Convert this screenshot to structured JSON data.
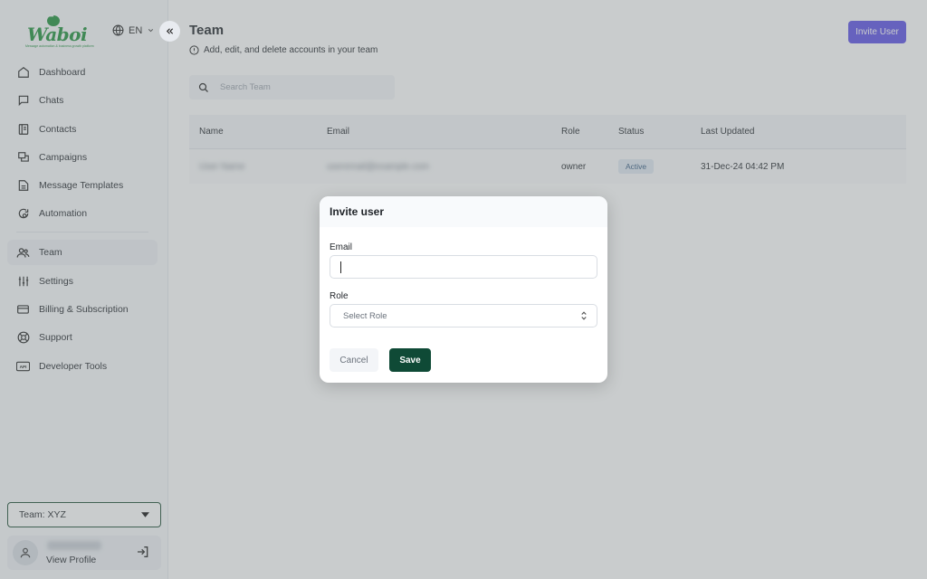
{
  "brand": {
    "name": "Waboi",
    "tagline": "Message automation & business growth platform",
    "color": "#1d8f3a"
  },
  "language": {
    "code": "EN"
  },
  "sidebar": {
    "items": [
      {
        "label": "Dashboard",
        "icon": "home-icon"
      },
      {
        "label": "Chats",
        "icon": "chat-icon"
      },
      {
        "label": "Contacts",
        "icon": "contacts-icon"
      },
      {
        "label": "Campaigns",
        "icon": "campaigns-icon"
      },
      {
        "label": "Message Templates",
        "icon": "template-icon"
      },
      {
        "label": "Automation",
        "icon": "automation-icon"
      },
      {
        "label": "Team",
        "icon": "team-icon",
        "active": true
      },
      {
        "label": "Settings",
        "icon": "sliders-icon"
      },
      {
        "label": "Billing & Subscription",
        "icon": "card-icon"
      },
      {
        "label": "Support",
        "icon": "lifebuoy-icon"
      },
      {
        "label": "Developer Tools",
        "icon": "api-icon"
      }
    ],
    "team_select": "Team: XYZ",
    "profile": {
      "name": "User Name",
      "link": "View Profile"
    }
  },
  "header": {
    "title": "Team",
    "subtitle": "Add, edit, and delete accounts in your team",
    "invite_button": "Invite User"
  },
  "search": {
    "placeholder": "Search Team"
  },
  "table": {
    "columns": [
      "Name",
      "Email",
      "Role",
      "Status",
      "Last Updated"
    ],
    "rows": [
      {
        "name": "User Name",
        "email": "useremail@example.com",
        "role": "owner",
        "status": "Active",
        "updated": "31-Dec-24 04:42 PM"
      }
    ]
  },
  "modal": {
    "title": "Invite user",
    "email_label": "Email",
    "email_value": "",
    "role_label": "Role",
    "role_placeholder": "Select Role",
    "cancel": "Cancel",
    "save": "Save"
  },
  "colors": {
    "primary": "#5b4fe6",
    "save": "#0f4a36",
    "team_border": "#1d4d34",
    "active_badge_bg": "#dfe8f2"
  }
}
